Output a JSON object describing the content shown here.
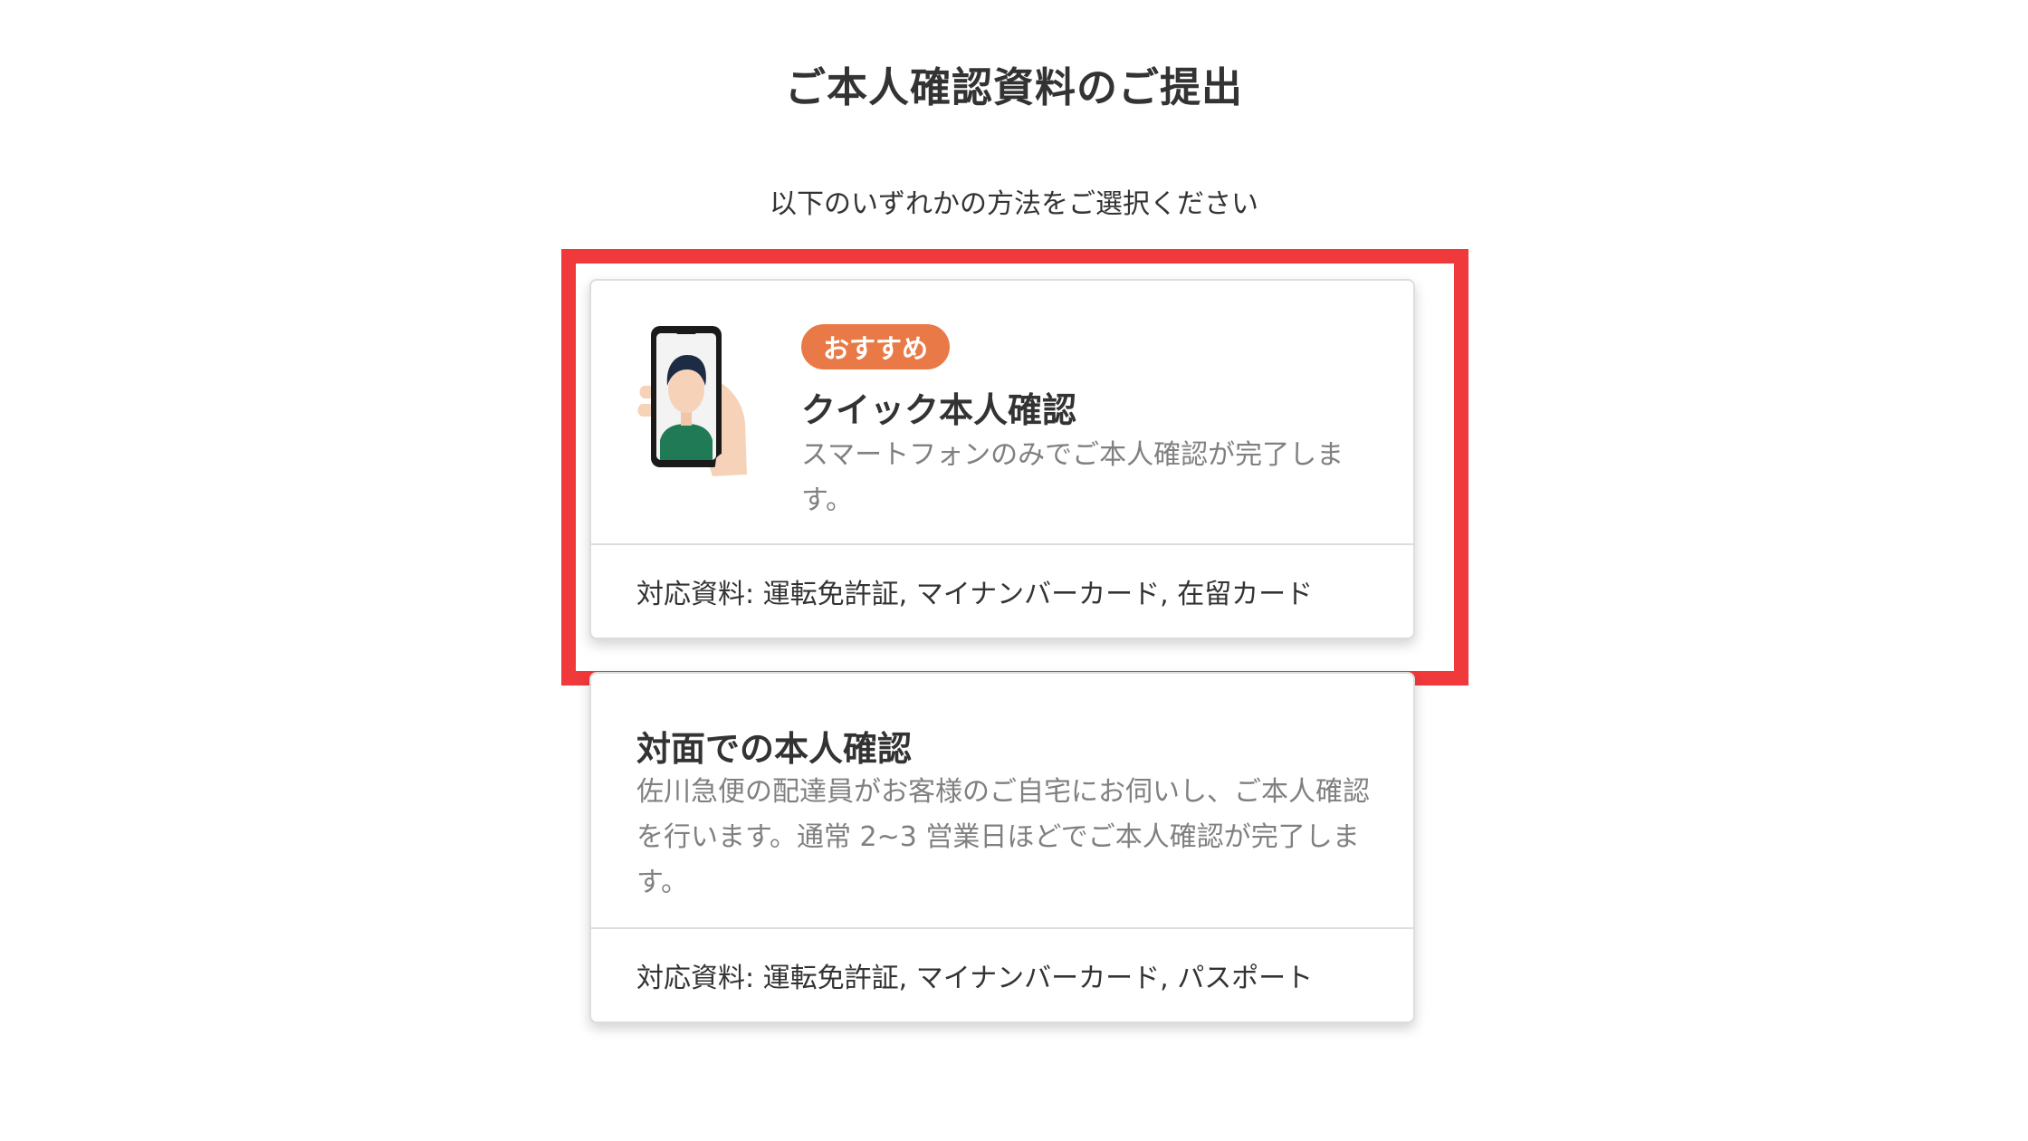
{
  "header": {
    "title": "ご本人確認資料のご提出",
    "subtitle": "以下のいずれかの方法をご選択ください"
  },
  "options": [
    {
      "badge": "おすすめ",
      "title": "クイック本人確認",
      "description": "スマートフォンのみでご本人確認が完了します。",
      "documents": "対応資料: 運転免許証, マイナンバーカード, 在留カード",
      "icon": "smartphone-selfie-icon",
      "highlighted": true
    },
    {
      "title": "対面での本人確認",
      "description": "佐川急便の配達員がお客様のご自宅にお伺いし、ご本人確認を行います。通常 2~3 営業日ほどでご本人確認が完了します。",
      "documents": "対応資料: 運転免許証, マイナンバーカード, パスポート",
      "highlighted": false
    }
  ],
  "colors": {
    "badge": "#e97a48",
    "highlight_frame": "#f0393b",
    "text_primary": "#333333",
    "text_secondary": "#808080"
  }
}
